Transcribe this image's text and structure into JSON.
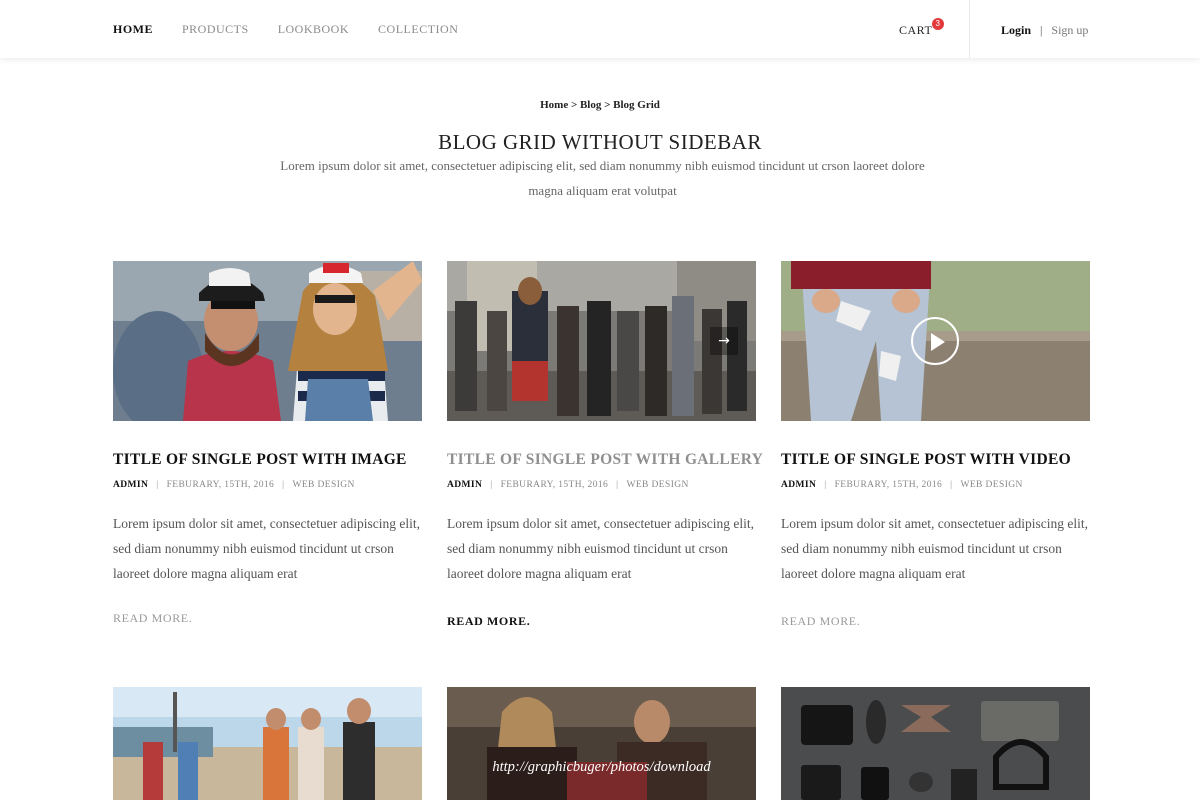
{
  "nav": {
    "items": [
      {
        "label": "HOME",
        "active": true
      },
      {
        "label": "PRODUCTS",
        "active": false
      },
      {
        "label": "LOOKBOOK",
        "active": false
      },
      {
        "label": "COLLECTION",
        "active": false
      }
    ],
    "cart_label": "CART",
    "cart_count": "3",
    "login_label": "Login",
    "separator": "|",
    "signup_label": "Sign up"
  },
  "breadcrumb": "Home > Blog > Blog Grid",
  "page": {
    "title": "BLOG GRID WITHOUT SIDEBAR",
    "description": "Lorem ipsum dolor sit amet, consectetuer adipiscing elit, sed diam nonummy nibh euismod tincidunt ut crson laoreet dolore magna aliquam erat volutpat"
  },
  "posts": [
    {
      "title": "TITLE OF SINGLE POST WITH IMAGE",
      "author": "ADMIN",
      "date": "FEBURARY, 15TH, 2016",
      "category": "WEB DESIGN",
      "excerpt": "Lorem ipsum dolor sit amet, consectetuer adipiscing elit, sed diam nonummy nibh euismod tincidunt ut crson laoreet dolore magna aliquam erat",
      "read_more": "READ MORE."
    },
    {
      "title": "TITLE OF SINGLE POST WITH GALLERY",
      "author": "ADMIN",
      "date": "FEBURARY, 15TH, 2016",
      "category": "WEB DESIGN",
      "excerpt": "Lorem ipsum dolor sit amet, consectetuer adipiscing elit, sed diam nonummy nibh euismod tincidunt ut crson laoreet dolore magna aliquam erat",
      "read_more": "READ MORE."
    },
    {
      "title": "TITLE OF SINGLE POST WITH VIDEO",
      "author": "ADMIN",
      "date": "FEBURARY, 15TH, 2016",
      "category": "WEB DESIGN",
      "excerpt": "Lorem ipsum dolor sit amet, consectetuer adipiscing elit, sed diam nonummy nibh euismod tincidunt ut crson laoreet dolore magna aliquam erat",
      "read_more": "READ MORE."
    }
  ],
  "second_row": {
    "caption": "http://graphicbuger/photos/download"
  },
  "icons": {
    "gallery_next": "arrow-right-icon",
    "video_play": "play-icon"
  },
  "colors": {
    "cart_badge": "#e23a3a",
    "accent_dark": "#111111",
    "muted_text": "#8f8f8f"
  }
}
